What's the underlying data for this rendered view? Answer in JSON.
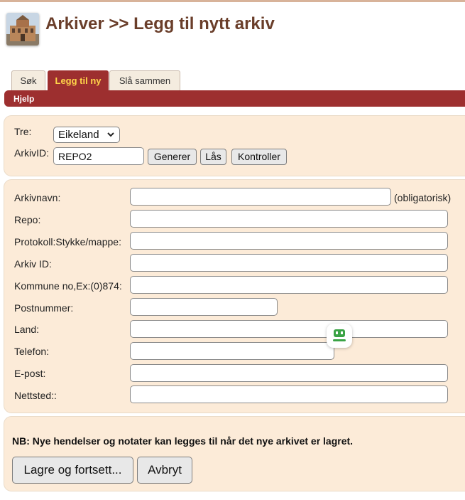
{
  "header": {
    "title": "Arkiver >> Legg til nytt arkiv"
  },
  "tabs": [
    {
      "label": "Søk",
      "active": false
    },
    {
      "label": "Legg til ny",
      "active": true
    },
    {
      "label": "Slå sammen",
      "active": false
    }
  ],
  "subbar": {
    "help_label": "Hjelp"
  },
  "tree_panel": {
    "tree_label": "Tre:",
    "tree_selected": "Eikeland",
    "archive_id_label": "ArkivID:",
    "archive_id_value": "REPO2",
    "generate_label": "Generer",
    "lock_label": "Lås",
    "check_label": "Kontroller"
  },
  "form": {
    "fields": [
      {
        "label": "Arkivnavn:",
        "value": ""
      },
      {
        "label": "Repo:",
        "value": ""
      },
      {
        "label": "Protokoll:Stykke/mappe:",
        "value": ""
      },
      {
        "label": "Arkiv ID:",
        "value": ""
      },
      {
        "label": "Kommune no,Ex:(0)874:",
        "value": ""
      },
      {
        "label": "Postnummer:",
        "value": ""
      },
      {
        "label": "Land:",
        "value": ""
      },
      {
        "label": "Telefon:",
        "value": ""
      },
      {
        "label": "E-post:",
        "value": ""
      },
      {
        "label": "Nettsted::",
        "value": ""
      }
    ],
    "required_note": "(obligatorisk)"
  },
  "footer": {
    "note": "NB: Nye hendelser og notater kan legges til når det nye arkivet er lagret.",
    "save_label": "Lagre og fortsett...",
    "cancel_label": "Avbryt"
  },
  "colors": {
    "accent": "#9d2f2f",
    "tab_active_text": "#ffd54a",
    "panel_bg": "#fcebd8",
    "title": "#6a3e2a"
  }
}
